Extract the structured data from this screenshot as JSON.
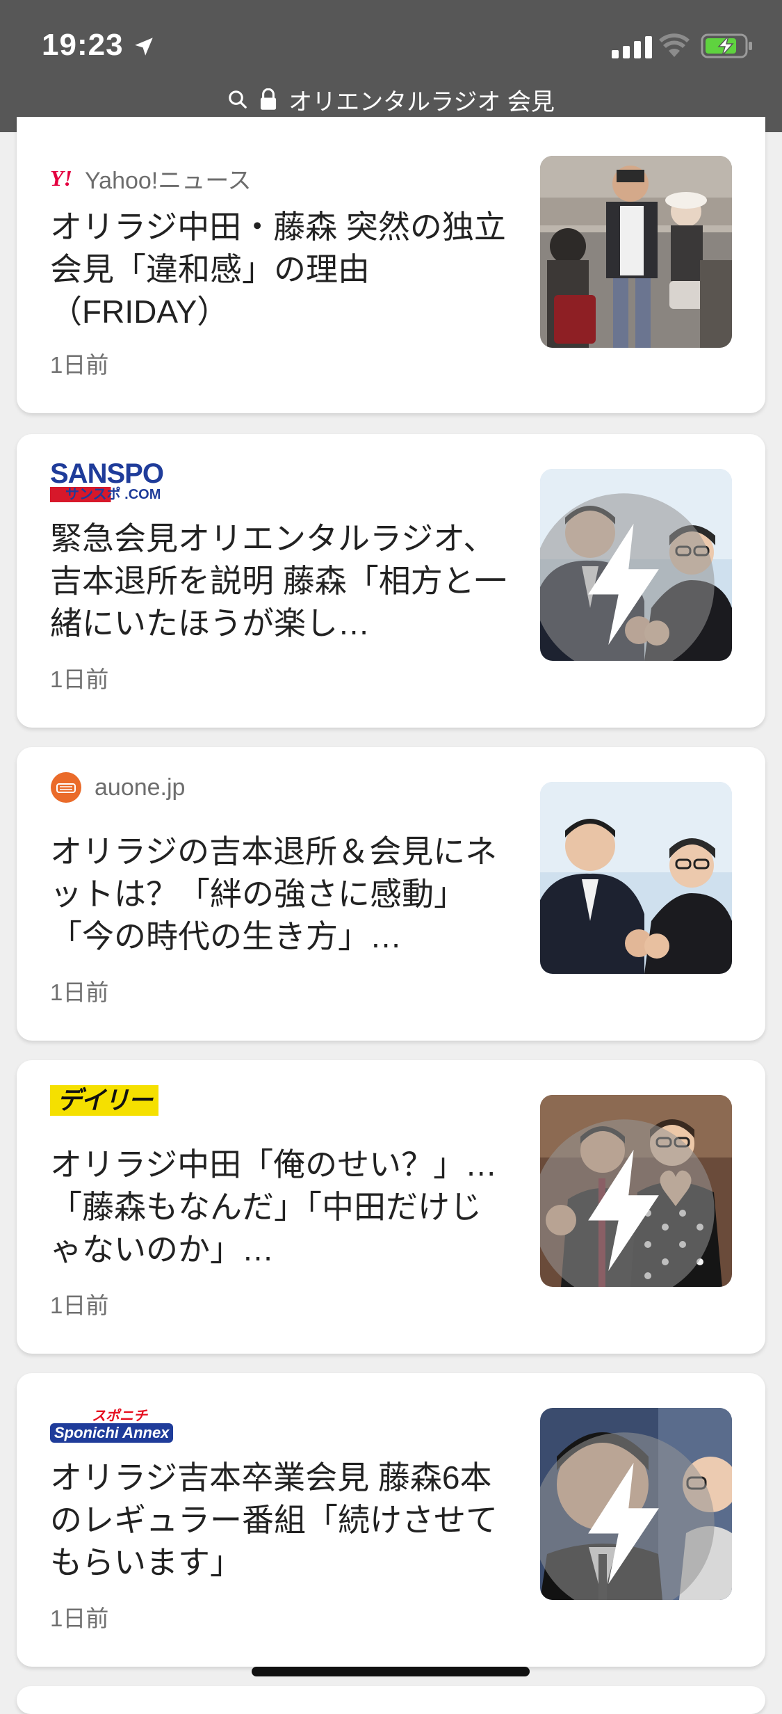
{
  "status_bar": {
    "time": "19:23",
    "url_text": "オリエンタルラジオ 会見"
  },
  "cards": [
    {
      "source": "Yahoo!ニュース",
      "logo_text": "Y!",
      "headline": "オリラジ中田・藤森 突然の独立会見「違和感」の理由（FRIDAY）",
      "time_ago": "1日前",
      "image": "photo-airport-couple",
      "amp": false
    },
    {
      "source": "SANSPO .COM",
      "logo_text": "SANSPO",
      "logo_sub": "サンスポ .COM",
      "headline": "緊急会見オリエンタルラジオ、吉本退所を説明 藤森「相方と一緒にいたほうが楽し…",
      "time_ago": "1日前",
      "image": "photo-duo-pose",
      "amp": true
    },
    {
      "source": "auone.jp",
      "headline": "オリラジの吉本退所＆会見にネットは？「絆の強さに感動」「今の時代の生き方」…",
      "time_ago": "1日前",
      "image": "photo-duo-pose",
      "amp": false
    },
    {
      "source": "デイリー",
      "logo_text": "デイリー",
      "headline": "オリラジ中田「俺のせい？」…「藤森もなんだ」「中田だけじゃないのか」…",
      "time_ago": "1日前",
      "image": "photo-duo-heart",
      "amp": true
    },
    {
      "source": "Sponichi Annex",
      "logo_text": "スポニチ",
      "logo_sub": "Sponichi Annex",
      "headline": "オリラジ吉本卒業会見 藤森6本のレギュラー番組「続けさせてもらいます」",
      "time_ago": "1日前",
      "image": "photo-closeup",
      "amp": true
    }
  ],
  "colors": {
    "status_bg": "#575757",
    "page_bg": "#efefef",
    "card_bg": "#ffffff",
    "yahoo_red": "#e4003f",
    "sanspo_blue": "#1f3c9a",
    "daily_yellow": "#f5e000",
    "auone_orange": "#ea6b2a",
    "battery_green": "#5fd33f"
  }
}
